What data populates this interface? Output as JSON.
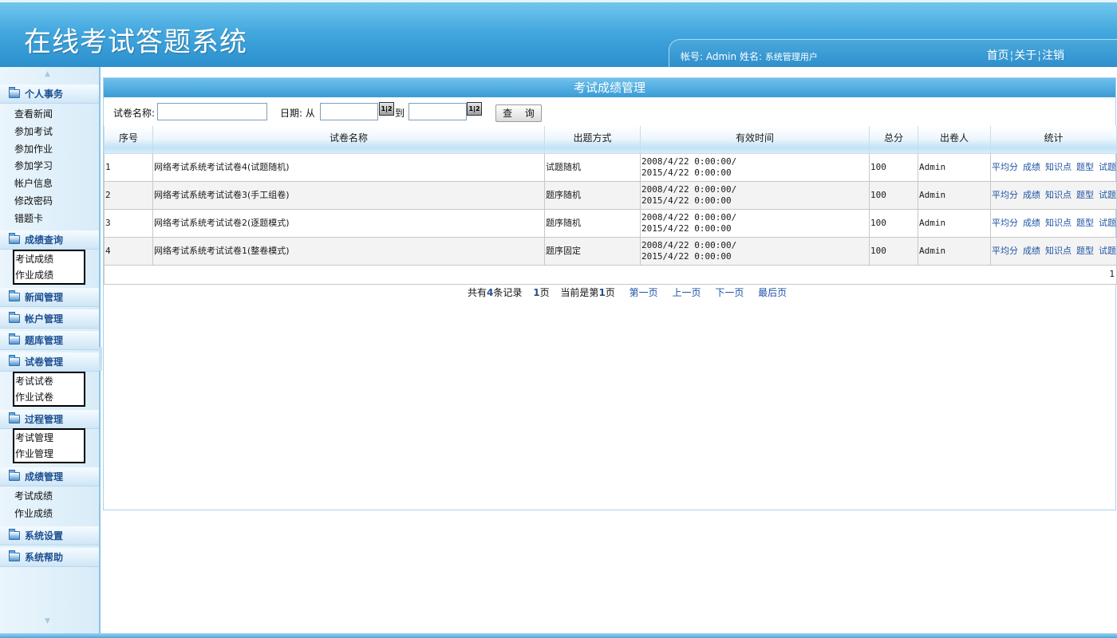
{
  "header": {
    "app_title": "在线考试答题系统",
    "account_label": "帐号:",
    "account_value": "Admin",
    "name_label": "姓名:",
    "name_value": "系统管理用户",
    "links": [
      "首页",
      "关于",
      "注销"
    ]
  },
  "sidebar": {
    "groups": [
      {
        "label": "个人事务",
        "icon": "folder-icon",
        "items": [
          "查看新闻",
          "参加考试",
          "参加作业",
          "参加学习",
          "帐户信息",
          "修改密码",
          "错题卡"
        ]
      },
      {
        "label": "成绩查询",
        "icon": "folder-icon",
        "items": [
          "考试成绩",
          "作业成绩"
        ]
      },
      {
        "label": "新闻管理",
        "icon": "folder-icon",
        "items": []
      },
      {
        "label": "帐户管理",
        "icon": "folder-icon",
        "items": []
      },
      {
        "label": "题库管理",
        "icon": "folder-icon",
        "items": []
      },
      {
        "label": "试卷管理",
        "icon": "folder-icon",
        "items": [
          "考试试卷",
          "作业试卷"
        ]
      },
      {
        "label": "过程管理",
        "icon": "folder-icon",
        "items": [
          "考试管理",
          "作业管理"
        ]
      },
      {
        "label": "成绩管理",
        "icon": "folder-icon",
        "items": [
          "考试成绩",
          "作业成绩"
        ]
      },
      {
        "label": "系统设置",
        "icon": "folder-icon",
        "items": []
      },
      {
        "label": "系统帮助",
        "icon": "folder-icon",
        "items": []
      }
    ]
  },
  "main": {
    "panel_title": "考试成绩管理",
    "search": {
      "paper_name_label": "试卷名称:",
      "paper_name_value": "",
      "date_label": "日期: 从",
      "to_label": "到",
      "date_from_value": "",
      "date_to_value": "",
      "calendar_icon_text": "1|2",
      "query_label": "查 询"
    },
    "table": {
      "columns": [
        "序号",
        "试卷名称",
        "出题方式",
        "有效时间",
        "总分",
        "出卷人",
        "统计"
      ],
      "rows": [
        {
          "no": "1",
          "name": "网络考试系统考试试卷4(试题随机)",
          "mode": "试题随机",
          "time_from": "2008/4/22 0:00:00/",
          "time_to": "2015/4/22 0:00:00",
          "score": "100",
          "author": "Admin"
        },
        {
          "no": "2",
          "name": "网络考试系统考试试卷3(手工组卷)",
          "mode": "题序随机",
          "time_from": "2008/4/22 0:00:00/",
          "time_to": "2015/4/22 0:00:00",
          "score": "100",
          "author": "Admin"
        },
        {
          "no": "3",
          "name": "网络考试系统考试试卷2(逐题模式)",
          "mode": "题序随机",
          "time_from": "2008/4/22 0:00:00/",
          "time_to": "2015/4/22 0:00:00",
          "score": "100",
          "author": "Admin"
        },
        {
          "no": "4",
          "name": "网络考试系统考试试卷1(整卷模式)",
          "mode": "题序固定",
          "time_from": "2008/4/22 0:00:00/",
          "time_to": "2015/4/22 0:00:00",
          "score": "100",
          "author": "Admin"
        }
      ],
      "stat_links": [
        "平均分",
        "成绩",
        "知识点",
        "题型",
        "试题"
      ],
      "page_indicator": "1"
    },
    "pager": {
      "prefix": "共有",
      "record_count": "4",
      "records_suffix": "条记录",
      "total_pages": "1",
      "pages_suffix": "页",
      "current_prefix": "当前是第",
      "current_page": "1",
      "current_suffix": "页",
      "first": "第一页",
      "prev": "上一页",
      "next": "下一页",
      "last": "最后页"
    }
  }
}
